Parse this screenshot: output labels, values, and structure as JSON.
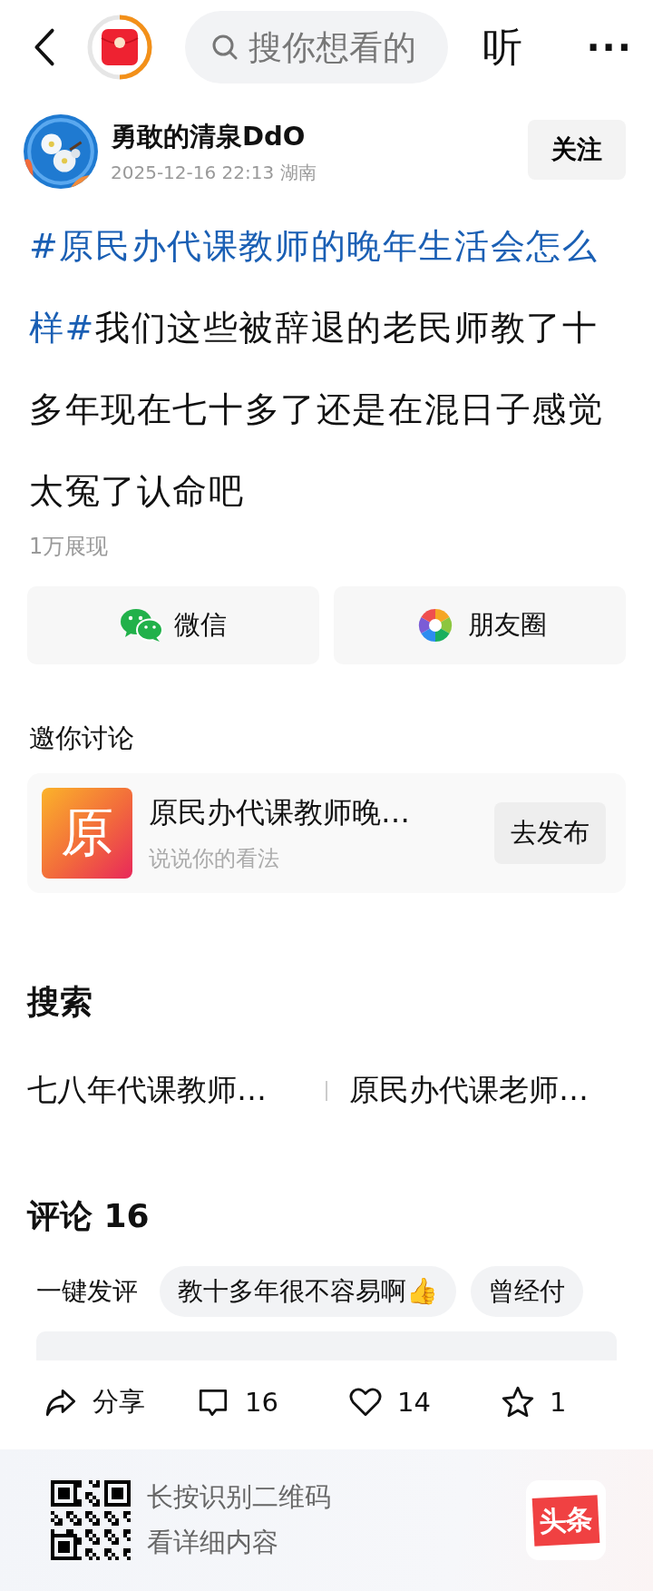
{
  "top_bar": {
    "search_placeholder": "搜你想看的",
    "listen": "听",
    "more": "···"
  },
  "author": {
    "name": "勇敢的清泉DdO",
    "meta": "2025-12-16 22:13 湖南",
    "follow": "关注"
  },
  "post": {
    "segments": [
      {
        "kind": "hashtag",
        "text": "#原民办代课教师的晚年生活会怎么样#"
      },
      {
        "kind": "text",
        "text": "我们这些被辞退的老民师教了十多年现在七十多了还是在混日子感觉太冤了认命吧"
      }
    ],
    "views": "1万展现"
  },
  "share_buttons": [
    {
      "kind": "wechat",
      "label": "微信"
    },
    {
      "kind": "moments",
      "label": "朋友圈"
    }
  ],
  "invite": {
    "heading": "邀你讨论",
    "badge": "原",
    "topic": "原民办代课教师晚…",
    "hint": "说说你的看法",
    "action": "去发布"
  },
  "search": {
    "heading": "搜索",
    "items": [
      "七八年代课教师…",
      "原民办代课老师…"
    ]
  },
  "comments": {
    "heading": "评论 16",
    "quick_label": "一键发评",
    "chips": [
      "教十多年很不容易啊👍",
      "曾经付"
    ]
  },
  "toolbar": [
    {
      "kind": "share",
      "label": "分享"
    },
    {
      "kind": "comment",
      "label": "16"
    },
    {
      "kind": "like",
      "label": "14"
    },
    {
      "kind": "star",
      "label": "1"
    }
  ],
  "footer": {
    "lines": [
      "长按识别二维码",
      "看详细内容"
    ],
    "logo": "头条"
  }
}
